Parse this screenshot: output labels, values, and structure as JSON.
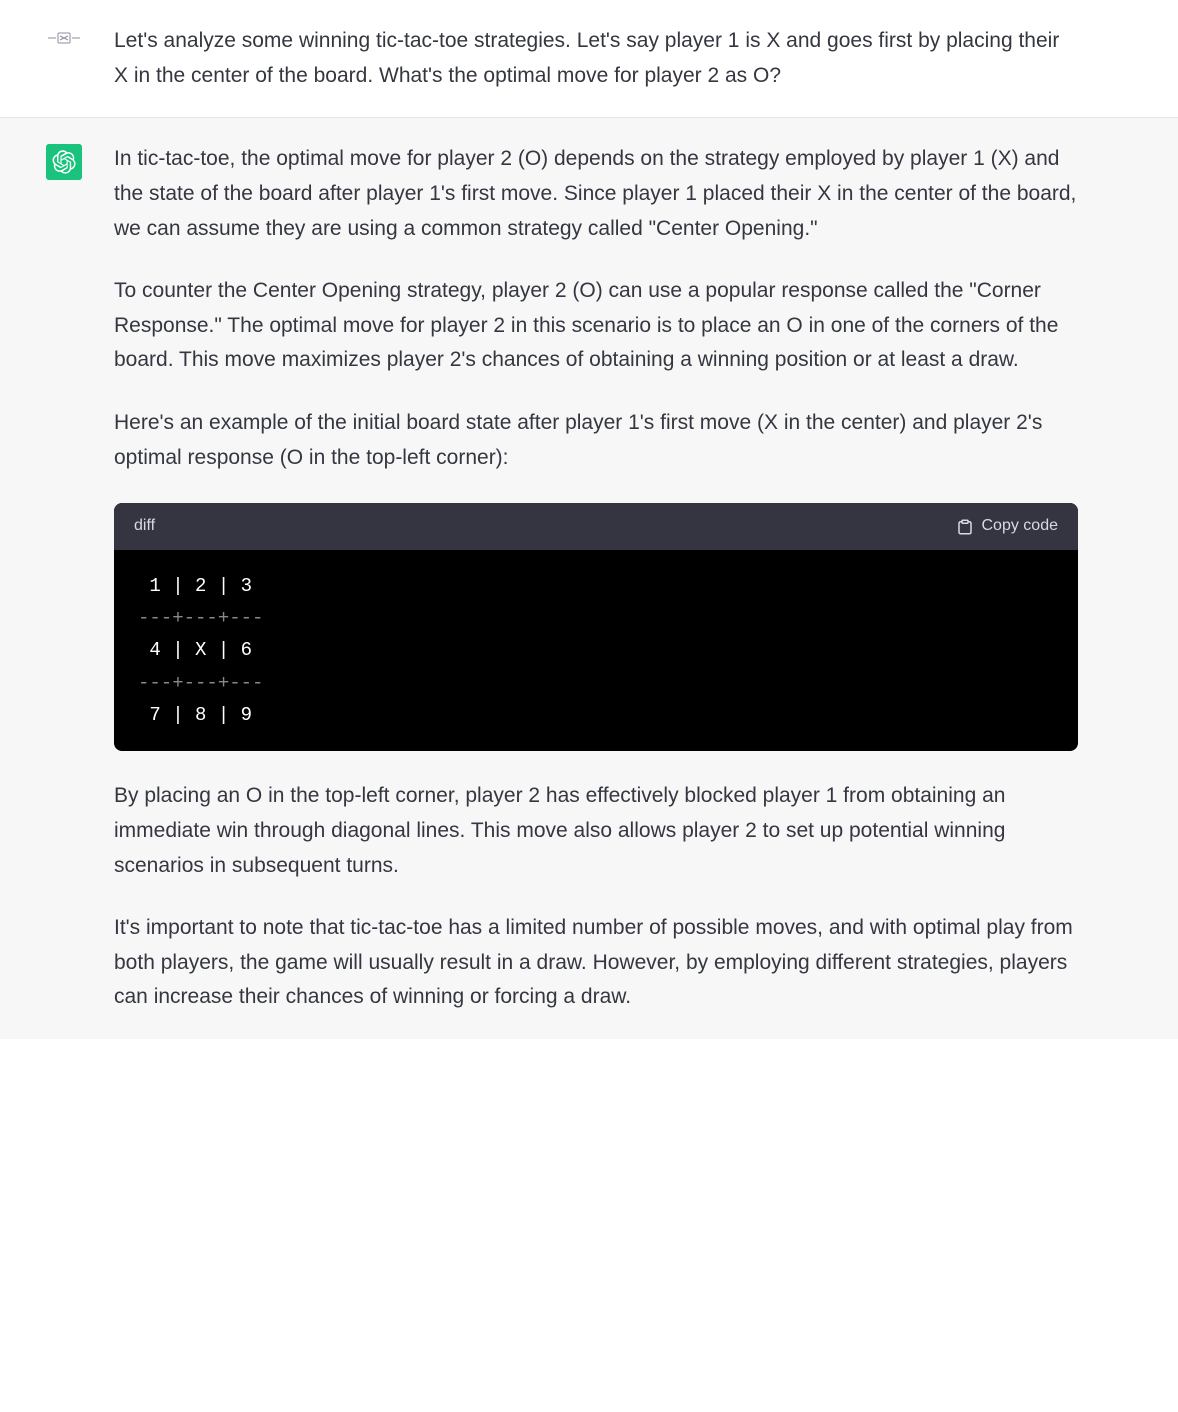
{
  "user_message": {
    "text": "Let's analyze some winning tic-tac-toe strategies. Let's say player 1 is X and goes first by placing their X in the center of the board. What's the optimal move for player 2 as O?"
  },
  "assistant_message": {
    "p1": "In tic-tac-toe, the optimal move for player 2 (O) depends on the strategy employed by player 1 (X) and the state of the board after player 1's first move. Since player 1 placed their X in the center of the board, we can assume they are using a common strategy called \"Center Opening.\"",
    "p2": "To counter the Center Opening strategy, player 2 (O) can use a popular response called the \"Corner Response.\" The optimal move for player 2 in this scenario is to place an O in one of the corners of the board. This move maximizes player 2's chances of obtaining a winning position or at least a draw.",
    "p3": "Here's an example of the initial board state after player 1's first move (X in the center) and player 2's optimal response (O in the top-left corner):",
    "p4": "By placing an O in the top-left corner, player 2 has effectively blocked player 1 from obtaining an immediate win through diagonal lines. This move also allows player 2 to set up potential winning scenarios in subsequent turns.",
    "p5": "It's important to note that tic-tac-toe has a limited number of possible moves, and with optimal play from both players, the game will usually result in a draw. However, by employing different strategies, players can increase their chances of winning or forcing a draw."
  },
  "code": {
    "language": "diff",
    "copy_label": "Copy code",
    "row1": " 1 | 2 | 3",
    "sep1": "---+---+---",
    "row2": " 4 | X | 6",
    "sep2": "---+---+---",
    "row3": " 7 | 8 | 9"
  },
  "user_avatar_text": "-⌂⌂-"
}
